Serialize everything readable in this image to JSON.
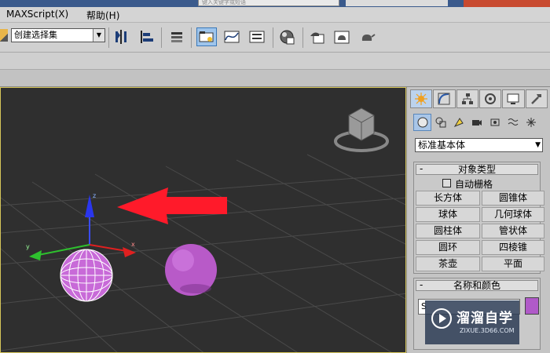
{
  "top": {
    "search_placeholder": "键入关键字或短语"
  },
  "menu": {
    "items": [
      "MAXScript(X)",
      "帮助(H)"
    ]
  },
  "toolbar": {
    "selection_set": {
      "value": "创建选择集"
    },
    "icons": [
      "mirror-icon",
      "align-icon",
      "layer-manager-icon",
      "scene-explorer-icon",
      "curve-editor-icon",
      "schematic-view-icon",
      "material-editor-icon",
      "render-setup-icon",
      "rendered-frame-icon",
      "render-teapot-icon",
      "render-quick-icon"
    ]
  },
  "viewport": {
    "objects": [
      "selected-sphere",
      "sphere"
    ],
    "colors": {
      "background": "#2f2f2f",
      "grid": "#484848",
      "arrow": "#ff1a2a",
      "sphere": "#b85ac8"
    }
  },
  "command_panel": {
    "tabs": [
      "create-tab",
      "modify-tab",
      "hierarchy-tab",
      "motion-tab",
      "display-tab",
      "utilities-tab"
    ],
    "category": "标准基本体",
    "object_type": {
      "title": "对象类型",
      "autogrid_label": "自动栅格",
      "buttons": [
        [
          "长方体",
          "圆锥体"
        ],
        [
          "球体",
          "几何球体"
        ],
        [
          "圆柱体",
          "管状体"
        ],
        [
          "圆环",
          "四棱锥"
        ],
        [
          "茶壶",
          "平面"
        ]
      ]
    },
    "name_color": {
      "title": "名称和颜色",
      "name_value": "S",
      "color": "#b05ac8"
    }
  },
  "watermark": {
    "title": "溜溜自学",
    "subtitle": "ZIXUE.3D66.COM"
  }
}
